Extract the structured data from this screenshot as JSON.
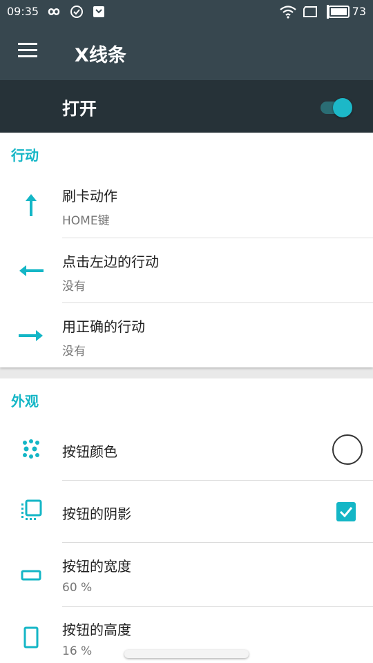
{
  "status_bar": {
    "time": "09:35",
    "battery": "73",
    "left_icons": [
      "infinity-icon",
      "check-circle-icon",
      "shield-icon"
    ],
    "right_icons": [
      "wifi-icon",
      "screen-rotation-icon",
      "battery-icon"
    ]
  },
  "app_bar": {
    "title": "X线条",
    "menu_icon": "hamburger-menu-icon"
  },
  "master_switch": {
    "label": "打开",
    "enabled": true
  },
  "actions": {
    "title": "行动",
    "items": [
      {
        "title": "刷卡动作",
        "subtitle": "HOME键",
        "icon": "arrow-up-icon"
      },
      {
        "title": "点击左边的行动",
        "subtitle": "没有",
        "icon": "arrow-left-icon"
      },
      {
        "title": "用正确的行动",
        "subtitle": "没有",
        "icon": "arrow-right-icon"
      }
    ]
  },
  "appearance": {
    "title": "外观",
    "items": [
      {
        "title": "按钮颜色",
        "icon": "palette-dots-icon",
        "control": "color-circle"
      },
      {
        "title": "按钮的阴影",
        "icon": "shadow-icon",
        "control": "checkbox",
        "checked": true
      },
      {
        "title": "按钮的宽度",
        "subtitle": "60 %",
        "icon": "width-icon"
      },
      {
        "title": "按钮的高度",
        "subtitle": "16 %",
        "icon": "height-icon"
      }
    ]
  },
  "colors": {
    "accent": "#14b6c6",
    "app_bar": "#37474f",
    "master_bar": "#263238"
  }
}
